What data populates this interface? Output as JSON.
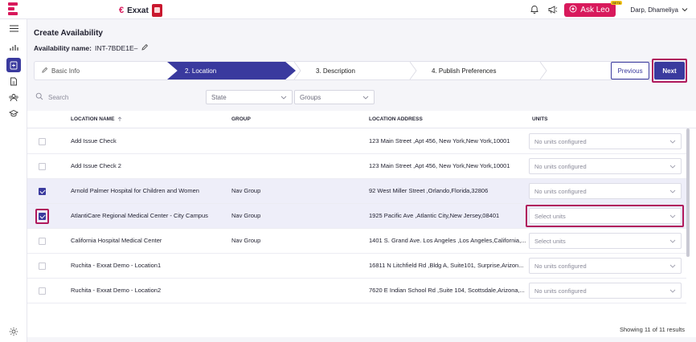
{
  "app": {
    "brand_name": "Exxat",
    "brand_color": "#d8195c",
    "accent_color": "#3a3a9e",
    "highlight_color": "#b0185c"
  },
  "header": {
    "ask_leo_label": "Ask Leo",
    "beta_label": "BETA",
    "user_name": "Darp, Dhameliya"
  },
  "page": {
    "title": "Create Availability",
    "availability_name_label": "Availability name:",
    "availability_name_value": "INT-7BDE1E–"
  },
  "stepper": {
    "steps": [
      {
        "label": "Basic Info",
        "state": "done"
      },
      {
        "label": "2.  Location",
        "state": "active"
      },
      {
        "label": "3.  Description",
        "state": "pending"
      },
      {
        "label": "4.  Publish Preferences",
        "state": "pending"
      }
    ],
    "previous_label": "Previous",
    "next_label": "Next"
  },
  "filters": {
    "search_placeholder": "Search",
    "state_placeholder": "State",
    "groups_placeholder": "Groups"
  },
  "table": {
    "columns": {
      "location_name": "LOCATION NAME",
      "group": "GROUP",
      "location_address": "LOCATION ADDRESS",
      "units": "UNITS"
    },
    "rows": [
      {
        "checked": false,
        "name": "Add Issue Check",
        "group": "",
        "address": "123 Main Street ,Apt 456, New York,New York,10001",
        "units": "No units configured"
      },
      {
        "checked": false,
        "name": "Add Issue Check 2",
        "group": "",
        "address": "123 Main Street ,Apt 456, New York,New York,10001",
        "units": "No units configured"
      },
      {
        "checked": true,
        "name": "Arnold Palmer Hospital for Children and Women",
        "group": "Nav Group",
        "address": "92 West Miller Street ,Orlando,Florida,32806",
        "units": "No units configured"
      },
      {
        "checked": true,
        "name": "AtlantiCare Regional Medical Center - City Campus",
        "group": "Nav Group",
        "address": "1925 Pacific Ave ,Atlantic City,New Jersey,08401",
        "units": "Select units"
      },
      {
        "checked": false,
        "name": "California Hospital Medical Center",
        "group": "Nav Group",
        "address": "1401 S. Grand Ave. Los Angeles ,Los Angeles,California,...",
        "units": "Select units"
      },
      {
        "checked": false,
        "name": "Ruchita - Exxat Demo - Location1",
        "group": "",
        "address": "16811 N Litchfield Rd ,Bldg A, Suite101, Surprise,Arizon...",
        "units": "No units configured"
      },
      {
        "checked": false,
        "name": "Ruchita - Exxat Demo - Location2",
        "group": "",
        "address": "7620 E Indian School Rd ,Suite 104, Scottsdale,Arizona,...",
        "units": "No units configured"
      }
    ],
    "showing_text": "Showing 11 of 11 results"
  }
}
